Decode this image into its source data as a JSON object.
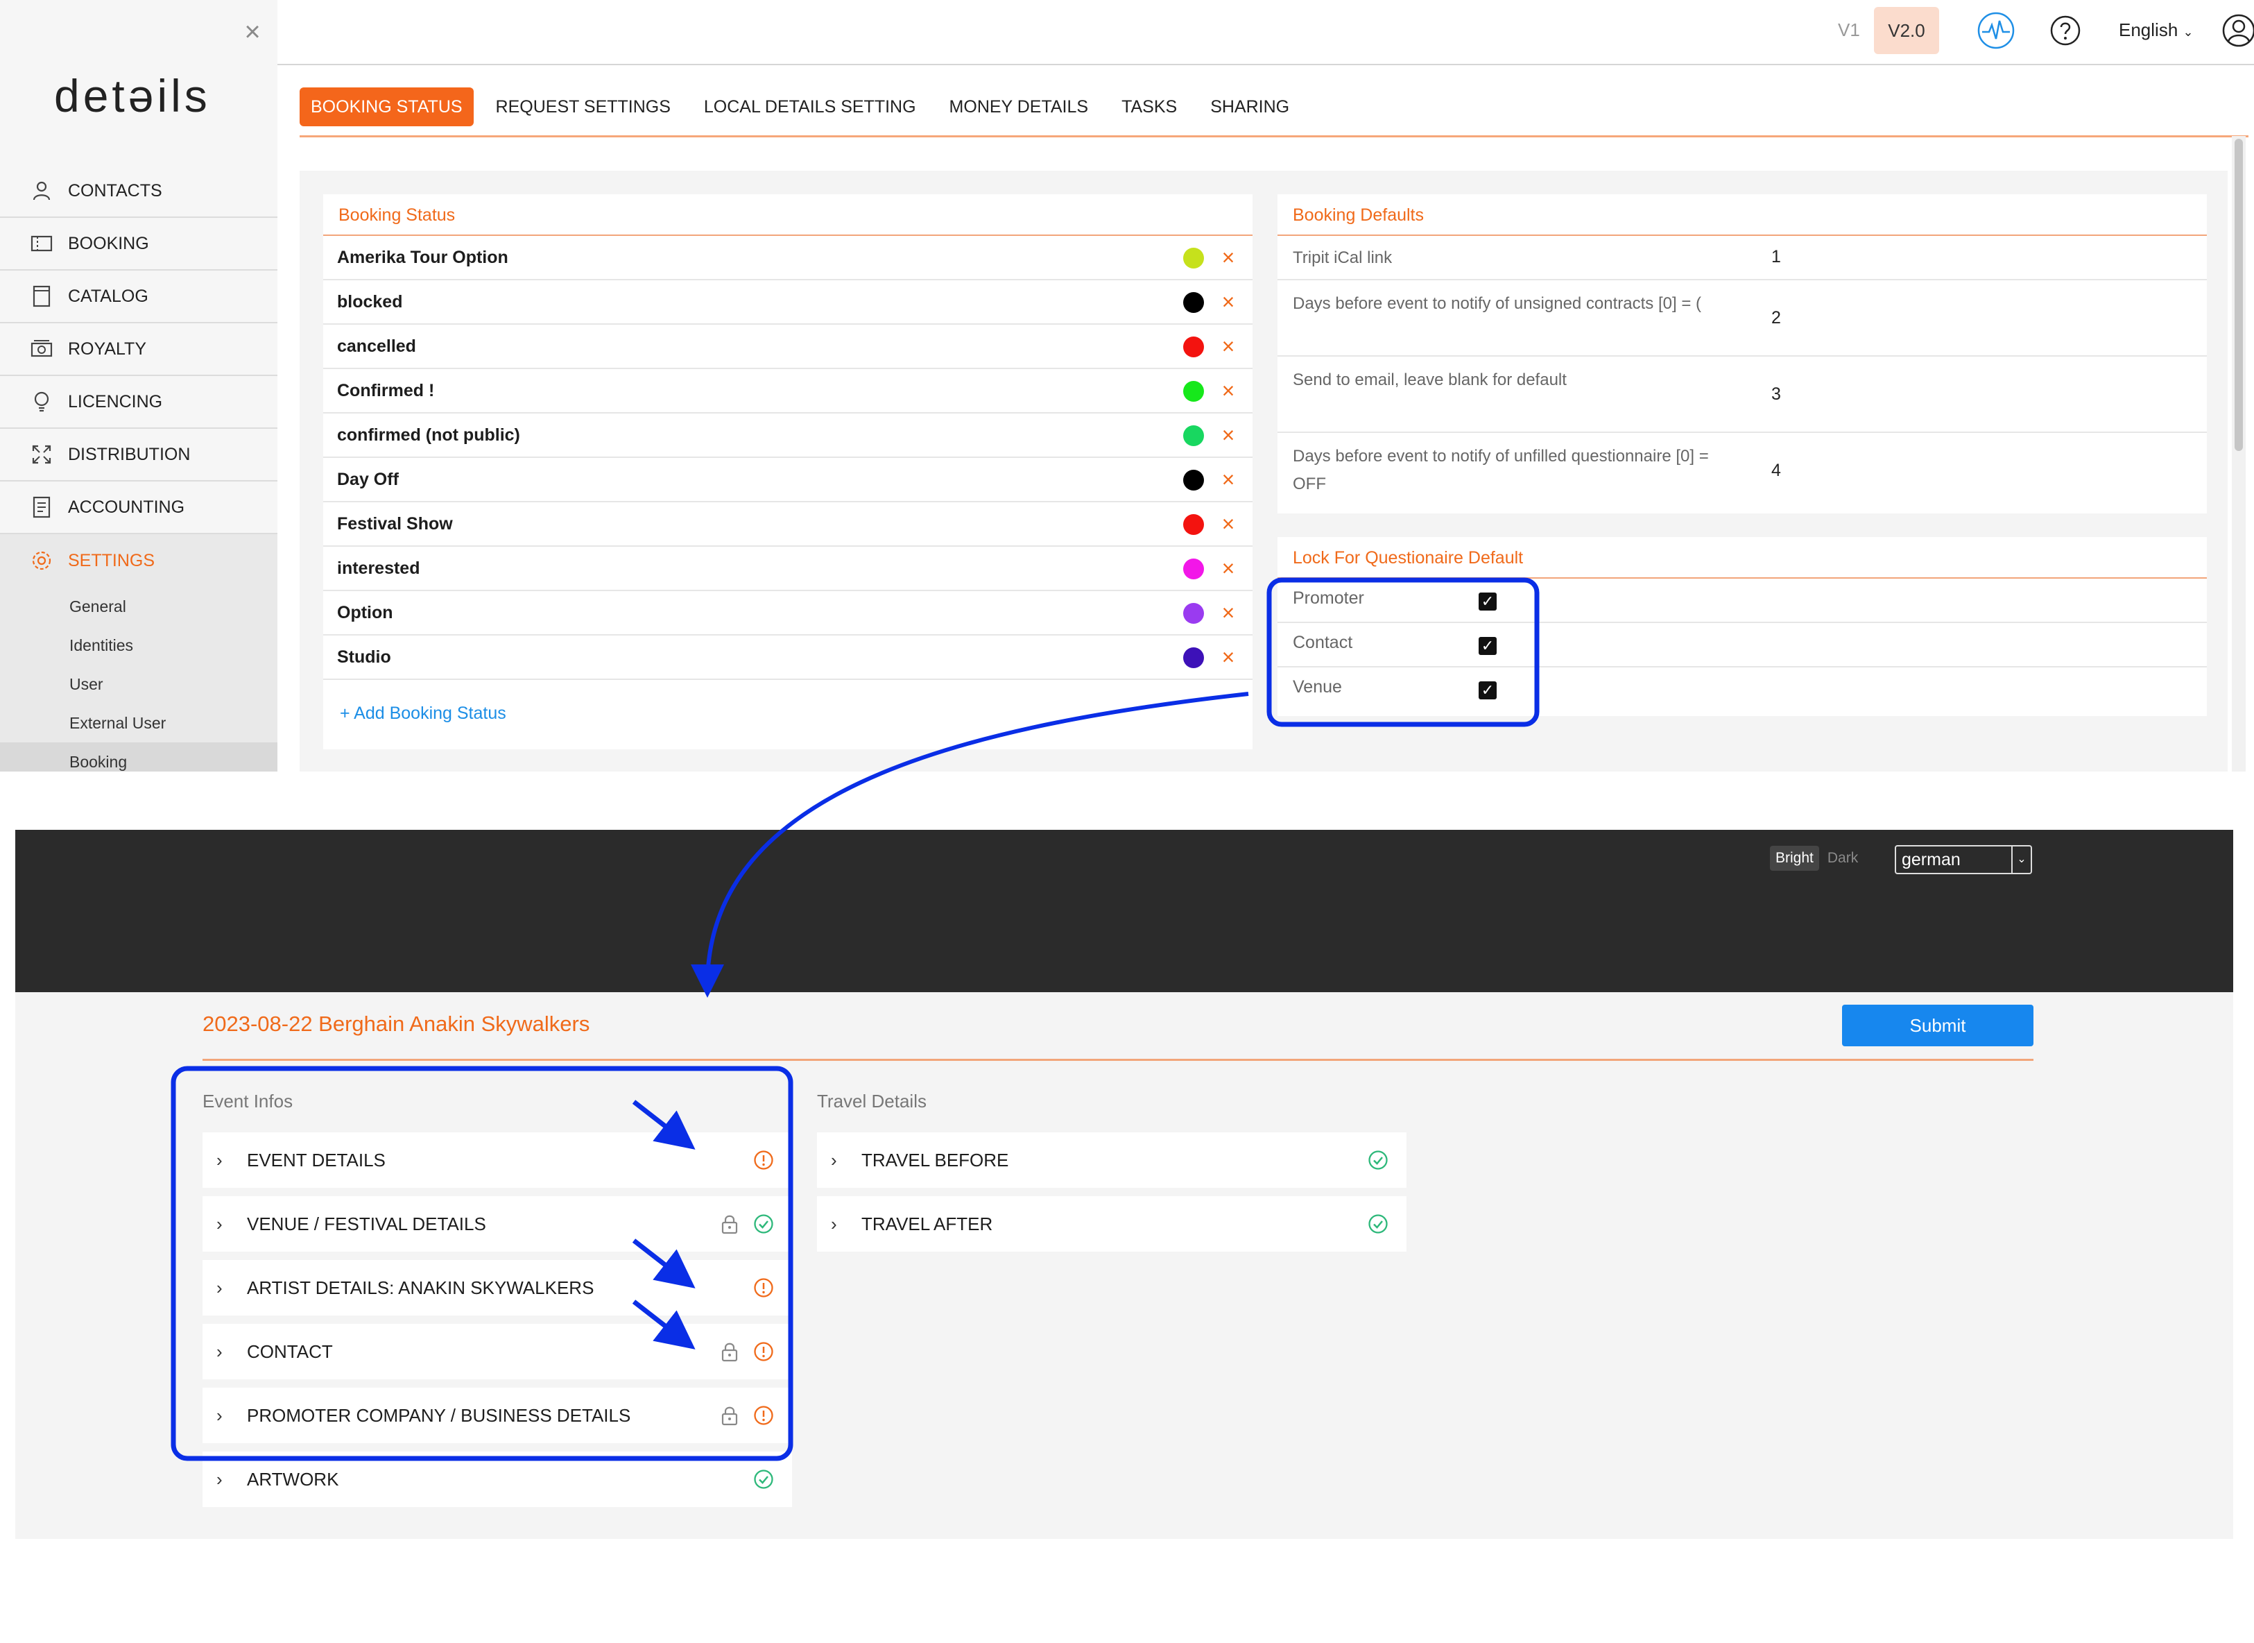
{
  "sidebar": {
    "logo": "detəils",
    "nav": [
      {
        "label": "CONTACTS",
        "icon": "person-icon"
      },
      {
        "label": "BOOKING",
        "icon": "ticket-icon"
      },
      {
        "label": "CATALOG",
        "icon": "catalog-icon"
      },
      {
        "label": "ROYALTY",
        "icon": "money-icon"
      },
      {
        "label": "LICENCING",
        "icon": "bulb-icon"
      },
      {
        "label": "DISTRIBUTION",
        "icon": "expand-icon"
      },
      {
        "label": "ACCOUNTING",
        "icon": "document-icon"
      },
      {
        "label": "SETTINGS",
        "icon": "gear-icon"
      }
    ],
    "settings_sub": [
      "General",
      "Identities",
      "User",
      "External User",
      "Booking"
    ]
  },
  "topbar": {
    "v1": "V1",
    "v2": "V2.0",
    "language": "English"
  },
  "tabs": [
    "BOOKING STATUS",
    "REQUEST SETTINGS",
    "LOCAL DETAILS SETTING",
    "MONEY DETAILS",
    "TASKS",
    "SHARING"
  ],
  "booking_status": {
    "title": "Booking Status",
    "items": [
      {
        "name": "Amerika Tour Option",
        "color": "#c6e11c"
      },
      {
        "name": "blocked",
        "color": "#000000"
      },
      {
        "name": "cancelled",
        "color": "#f3130f"
      },
      {
        "name": "Confirmed !",
        "color": "#16e81b"
      },
      {
        "name": "confirmed (not public)",
        "color": "#18d760"
      },
      {
        "name": "Day Off",
        "color": "#000000"
      },
      {
        "name": "Festival Show",
        "color": "#f3130f"
      },
      {
        "name": "interested",
        "color": "#f217e8"
      },
      {
        "name": "Option",
        "color": "#9a3bf0"
      },
      {
        "name": "Studio",
        "color": "#3d11b8"
      }
    ],
    "add_label": "+ Add Booking Status"
  },
  "booking_defaults": {
    "title": "Booking Defaults",
    "rows": [
      {
        "label": "Tripit iCal link",
        "value": "1"
      },
      {
        "label": "Days before event to notify of unsigned contracts [0] = (",
        "value": "2"
      },
      {
        "label": "Send to email, leave blank for default",
        "value": "3"
      },
      {
        "label": "Days before event to notify of unfilled questionnaire [0] = OFF",
        "value": "4"
      }
    ]
  },
  "lock_defaults": {
    "title": "Lock For Questionaire Default",
    "rows": [
      {
        "label": "Promoter",
        "checked": true
      },
      {
        "label": "Contact",
        "checked": true
      },
      {
        "label": "Venue",
        "checked": true
      }
    ]
  },
  "questionnaire": {
    "mode_bright": "Bright",
    "mode_dark": "Dark",
    "language": "german",
    "title": "2023-08-22 Berghain Anakin Skywalkers",
    "submit": "Submit",
    "event_infos_label": "Event Infos",
    "travel_details_label": "Travel Details",
    "event_sections": [
      {
        "label": "EVENT DETAILS",
        "status": "warning",
        "locked": false
      },
      {
        "label": "VENUE / FESTIVAL DETAILS",
        "status": "ok",
        "locked": true
      },
      {
        "label": "ARTIST DETAILS: ANAKIN SKYWALKERS",
        "status": "warning",
        "locked": false
      },
      {
        "label": "CONTACT",
        "status": "warning",
        "locked": true
      },
      {
        "label": "PROMOTER COMPANY / BUSINESS DETAILS",
        "status": "warning",
        "locked": true
      },
      {
        "label": "ARTWORK",
        "status": "ok",
        "locked": false
      }
    ],
    "travel_sections": [
      {
        "label": "TRAVEL BEFORE",
        "status": "ok"
      },
      {
        "label": "TRAVEL AFTER",
        "status": "ok"
      }
    ]
  },
  "colors": {
    "accent": "#f06a1a",
    "primary_blue": "#1787ee",
    "annotation_blue": "#0a2ee6",
    "ok_green": "#2db87a",
    "warning_orange": "#f06a1a"
  }
}
